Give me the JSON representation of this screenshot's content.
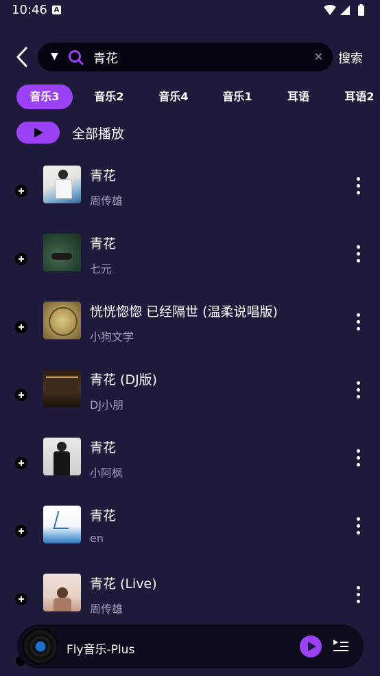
{
  "status": {
    "time": "10:46",
    "badge": "A"
  },
  "search": {
    "query": "青花",
    "button_label": "搜索"
  },
  "tabs": [
    "音乐3",
    "音乐2",
    "音乐4",
    "音乐1",
    "耳语",
    "耳语2"
  ],
  "play_all_label": "全部播放",
  "songs": [
    {
      "title": "青花",
      "artist": "周传雄"
    },
    {
      "title": "青花",
      "artist": "七元"
    },
    {
      "title": "恍恍惚惚 已经隔世 (温柔说唱版)",
      "artist": "小狗文学"
    },
    {
      "title": "青花 (DJ版)",
      "artist": "DJ小朋"
    },
    {
      "title": "青花",
      "artist": "小阿枫"
    },
    {
      "title": "青花",
      "artist": "en"
    },
    {
      "title": "青花 (Live)",
      "artist": "周传雄"
    }
  ],
  "player": {
    "title": "Fly音乐-Plus"
  },
  "colors": {
    "background": "#1d1a3b",
    "accent": "#9b41f7",
    "search_bg": "#050410",
    "secondary_text": "#a09eb7"
  }
}
